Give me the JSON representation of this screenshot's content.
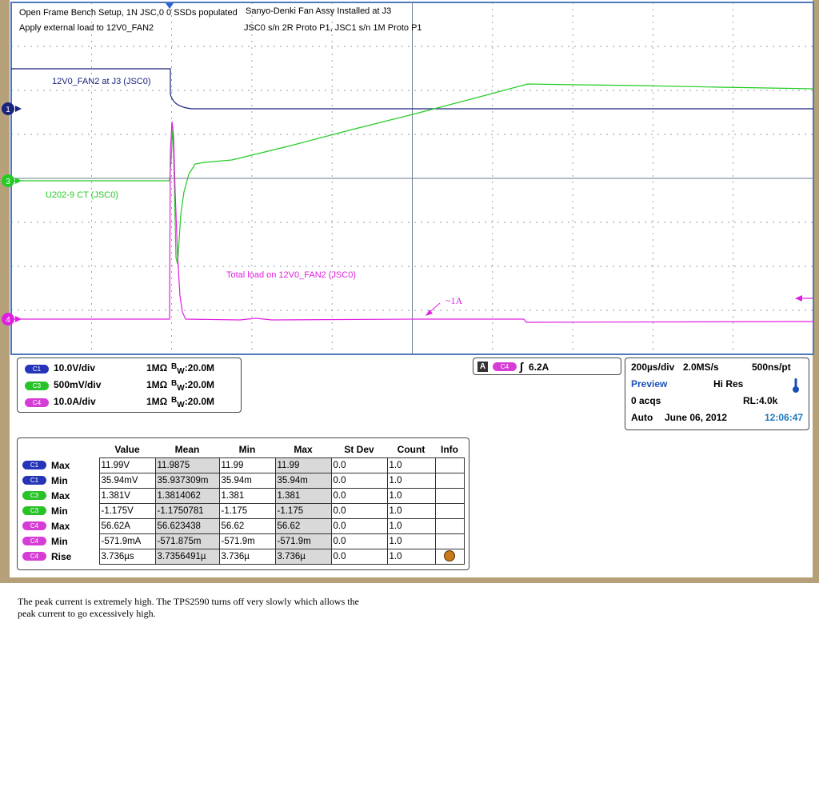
{
  "annotations": {
    "top_left_1": "Open Frame Bench Setup, 1N JSC,0 0 SSDs populated",
    "top_left_2": "Apply external load to 12V0_FAN2",
    "top_center_1": "Sanyo-Denki Fan Assy Installed at J3",
    "top_center_2": "JSC0 s/n 2R Proto P1, JSC1 s/n 1M Proto P1"
  },
  "traces": {
    "c1_label": "12V0_FAN2 at J3 (JSC0)",
    "c3_label": "U202-9 CT (JSC0)",
    "c4_label": "Total load on 12V0_FAN2 (JSC0)",
    "c4_callout": "~1A",
    "marker_1": "1",
    "marker_3": "3",
    "marker_4": "4"
  },
  "colors": {
    "c1": "#1a237e",
    "c3": "#22cc22",
    "c4": "#e020e0",
    "grid": "#6a7a90",
    "border": "#3d7bd4",
    "timestamp": "#1b78c0"
  },
  "channels": [
    {
      "chip": "C1",
      "scale": "10.0V/div",
      "coupling": "1MΩ",
      "bw_prefix": "B",
      "bw_sub": "W",
      "bw": ":20.0M",
      "color": "#2634b8"
    },
    {
      "chip": "C3",
      "scale": "500mV/div",
      "coupling": "1MΩ",
      "bw_prefix": "B",
      "bw_sub": "W",
      "bw": ":20.0M",
      "color": "#29c229"
    },
    {
      "chip": "C4",
      "scale": "10.0A/div",
      "coupling": "1MΩ",
      "bw_prefix": "B",
      "bw_sub": "W",
      "bw": ":20.0M",
      "color": "#d63dd6"
    }
  ],
  "trigger": {
    "mode_badge": "A",
    "source_chip": "C4",
    "slope_symbol": "∫",
    "level": "6.2A"
  },
  "timebase": {
    "time_div": "200µs/div",
    "sample_rate": "2.0MS/s",
    "resolution": "500ns/pt",
    "mode": "Preview",
    "acq_mode": "Hi Res",
    "acqs": "0 acqs",
    "record_length": "RL:4.0k",
    "trigger_mode": "Auto",
    "date": "June 06, 2012",
    "time": "12:06:47"
  },
  "measurements": {
    "headers": [
      "",
      "",
      "Value",
      "Mean",
      "Min",
      "Max",
      "St Dev",
      "Count",
      "Info"
    ],
    "rows": [
      {
        "chip": "C1",
        "color": "#2634b8",
        "stat": "Max",
        "value": "11.99V",
        "mean": "11.9875",
        "min": "11.99",
        "max": "11.99",
        "stdev": "0.0",
        "count": "1.0",
        "info": ""
      },
      {
        "chip": "C1",
        "color": "#2634b8",
        "stat": "Min",
        "value": "35.94mV",
        "mean": "35.937309m",
        "min": "35.94m",
        "max": "35.94m",
        "stdev": "0.0",
        "count": "1.0",
        "info": ""
      },
      {
        "chip": "C3",
        "color": "#29c229",
        "stat": "Max",
        "value": "1.381V",
        "mean": "1.3814062",
        "min": "1.381",
        "max": "1.381",
        "stdev": "0.0",
        "count": "1.0",
        "info": ""
      },
      {
        "chip": "C3",
        "color": "#29c229",
        "stat": "Min",
        "value": "-1.175V",
        "mean": "-1.1750781",
        "min": "-1.175",
        "max": "-1.175",
        "stdev": "0.0",
        "count": "1.0",
        "info": ""
      },
      {
        "chip": "C4",
        "color": "#d63dd6",
        "stat": "Max",
        "value": "56.62A",
        "mean": "56.623438",
        "min": "56.62",
        "max": "56.62",
        "stdev": "0.0",
        "count": "1.0",
        "info": ""
      },
      {
        "chip": "C4",
        "color": "#d63dd6",
        "stat": "Min",
        "value": "-571.9mA",
        "mean": "-571.875m",
        "min": "-571.9m",
        "max": "-571.9m",
        "stdev": "0.0",
        "count": "1.0",
        "info": ""
      },
      {
        "chip": "C4",
        "color": "#d63dd6",
        "stat": "Rise",
        "value": "3.736µs",
        "mean": "3.7356491µ",
        "min": "3.736µ",
        "max": "3.736µ",
        "stdev": "0.0",
        "count": "1.0",
        "info": "warning"
      }
    ]
  },
  "caption": "The peak current is extremely high. The TPS2590 turns off very slowly which allows the peak current to go excessively high."
}
